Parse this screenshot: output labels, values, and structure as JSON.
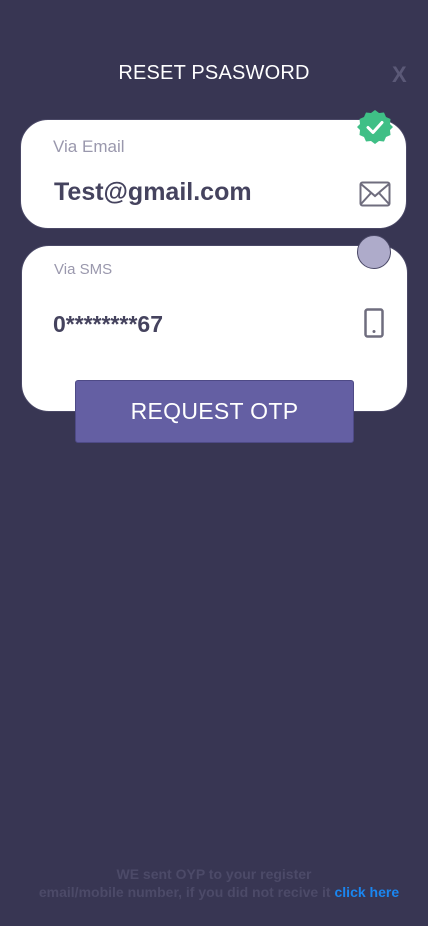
{
  "header": {
    "title": "RESET PSASWORD",
    "close_label": "X"
  },
  "email_option": {
    "label": "Via Email",
    "value": "Test@gmail.com",
    "selected": true,
    "icon": "mail-icon",
    "badge_icon": "check-icon",
    "badge_color": "#3fbf86"
  },
  "sms_option": {
    "label": "Via SMS",
    "value": "0********67",
    "selected": false,
    "icon": "phone-icon",
    "radio_color": "#aeabca"
  },
  "request_button": {
    "label": "REQUEST OTP",
    "color": "#645fa3"
  },
  "footer": {
    "line1": "WE sent OYP to your register",
    "line2": "email/mobile number, if you did not recive  it",
    "link": "click here",
    "link_color": "#1a86f0"
  },
  "colors": {
    "background": "#383653",
    "card": "#ffffff"
  }
}
